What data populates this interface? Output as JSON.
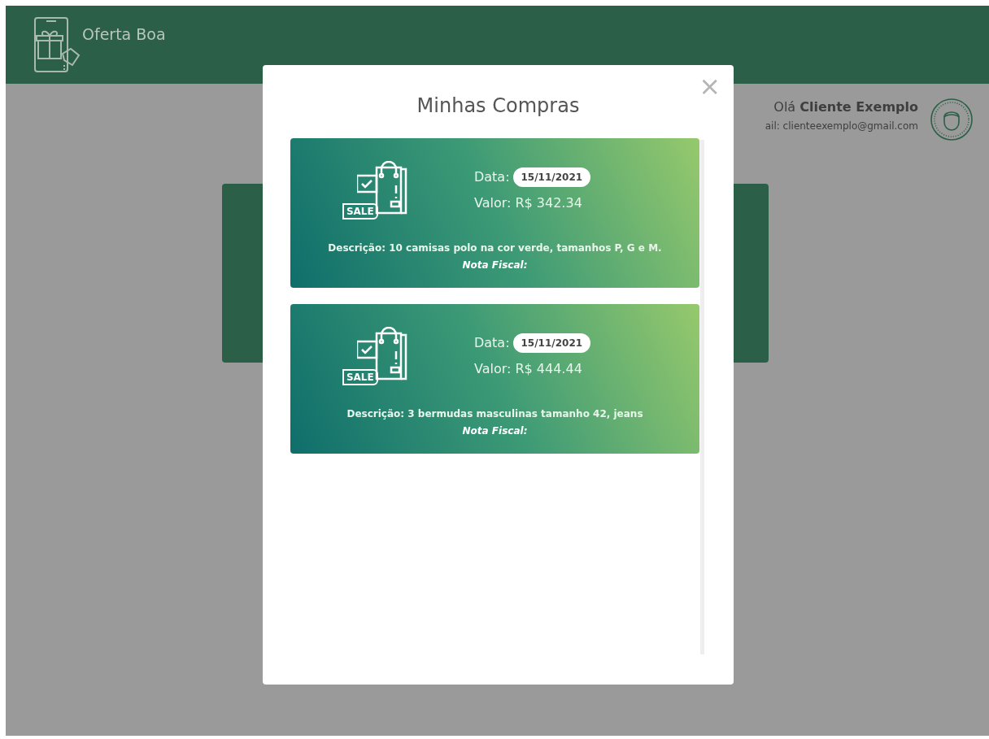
{
  "header": {
    "brand": "Oferta Boa"
  },
  "user": {
    "greeting": "Olá",
    "name": "Cliente Exemplo",
    "email": "ail: clienteexemplo@gmail.com"
  },
  "modal": {
    "title": "Minhas Compras",
    "close": "×",
    "purchases": [
      {
        "sale_tag": "SALE",
        "date_label": "Data:",
        "date": "15/11/2021",
        "value": "Valor: R$ 342.34",
        "description": "Descrição: 10 camisas polo na cor verde, tamanhos P, G e M.",
        "invoice": "Nota Fiscal:"
      },
      {
        "sale_tag": "SALE",
        "date_label": "Data:",
        "date": "15/11/2021",
        "value": "Valor: R$ 444.44",
        "description": "Descrição: 3 bermudas masculinas tamanho 42, jeans",
        "invoice": "Nota Fiscal:"
      }
    ]
  }
}
